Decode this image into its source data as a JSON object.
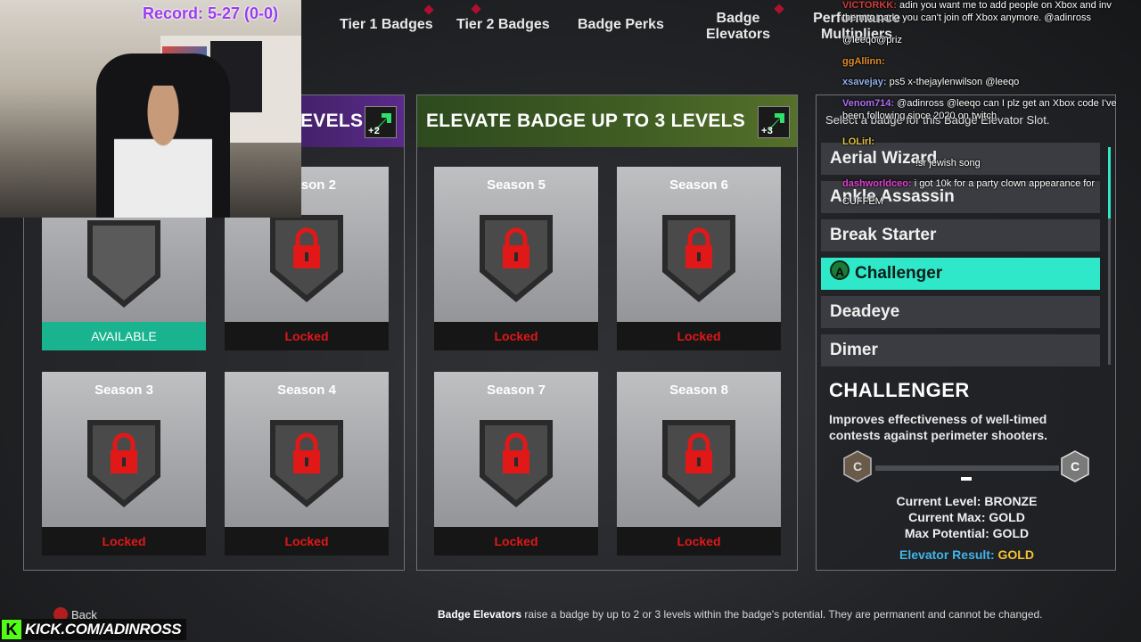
{
  "stream": {
    "record": "Record: 5-27 (0-0)",
    "kick_url": "KICK.COM/ADINROSS",
    "kick_logo": "K"
  },
  "tabs": [
    {
      "label": "Tier 1 Badges"
    },
    {
      "label": "Tier 2 Badges"
    },
    {
      "label": "Badge Perks"
    },
    {
      "label": "Badge Elevators"
    },
    {
      "label": "Performance Multipliers"
    }
  ],
  "left_panel": {
    "title": "EVELS",
    "level_badge": "+2",
    "slots": [
      {
        "title": "",
        "status": "AVAILABLE",
        "locked": false
      },
      {
        "title": "Season 2",
        "status": "Locked",
        "locked": true
      },
      {
        "title": "Season 3",
        "status": "Locked",
        "locked": true
      },
      {
        "title": "Season 4",
        "status": "Locked",
        "locked": true
      }
    ]
  },
  "middle_panel": {
    "title": "ELEVATE BADGE UP TO 3 LEVELS",
    "level_badge": "+3",
    "slots": [
      {
        "title": "Season 5",
        "status": "Locked",
        "locked": true
      },
      {
        "title": "Season 6",
        "status": "Locked",
        "locked": true
      },
      {
        "title": "Season 7",
        "status": "Locked",
        "locked": true
      },
      {
        "title": "Season 8",
        "status": "Locked",
        "locked": true
      }
    ]
  },
  "right_panel": {
    "header": "Select a badge for this Badge Elevator Slot.",
    "items": [
      {
        "label": "Aerial Wizard"
      },
      {
        "label": "Ankle Assassin"
      },
      {
        "label": "Break Starter"
      },
      {
        "label": "Challenger",
        "selected": true
      },
      {
        "label": "Deadeye"
      },
      {
        "label": "Dimer"
      }
    ],
    "select_button_glyph": "A",
    "detail": {
      "title": "CHALLENGER",
      "description": "Improves effectiveness of well-timed contests against perimeter shooters.",
      "current_level": "Current Level: BRONZE",
      "current_max": "Current Max: GOLD",
      "max_potential": "Max Potential: GOLD",
      "elevator_result_label": "Elevator Result:",
      "elevator_result_value": "GOLD"
    }
  },
  "chat": [
    {
      "user": "VICTORKK:",
      "msg": "adin you want me to add people on Xbox and inv",
      "color": "#d23c3c"
    },
    {
      "user": "",
      "msg": "them to park. you can't join off Xbox anymore. @adinross",
      "color": "#ffffff"
    },
    {
      "user": "",
      "msg": "@leeqo@priz",
      "color": "#ffffff"
    },
    {
      "user": "ggAllinn:",
      "msg": "",
      "color": "#e08a2a"
    },
    {
      "user": "xsavejay:",
      "msg": "ps5 x-thejaylenwilson @leeqo",
      "color": "#8fb0e8"
    },
    {
      "user": "Venom714:",
      "msg": "@adinross @leeqo can I plz get an Xbox code I've",
      "color": "#b070f0"
    },
    {
      "user": "",
      "msg": "been following since 2020 on twitch",
      "color": "#ffffff"
    },
    {
      "user": "LOLirl:",
      "msg": "",
      "color": "#e0c040"
    },
    {
      "user": "",
      "msg": "!sr jewish song",
      "color": "#ffffff"
    },
    {
      "user": "dashworldceo:",
      "msg": "i got 10k for a party clown appearance for",
      "color": "#e040d0"
    },
    {
      "user": "",
      "msg": "CUFFEM",
      "color": "#ffffff"
    }
  ],
  "footer": {
    "back_label": "Back",
    "note_bold": "Badge Elevators",
    "note_rest": " raise a badge by up to 2 or 3 levels within the badge's potential. They are permanent and cannot be changed."
  },
  "colors": {
    "accent": "#2ee8c9",
    "available": "#19b48f",
    "locked_text": "#e01818",
    "elevator_result": "#f3c431"
  }
}
